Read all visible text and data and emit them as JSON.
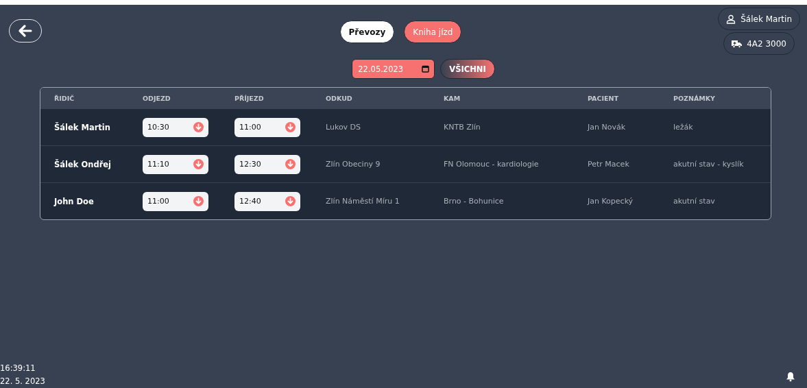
{
  "tabs": [
    {
      "label": "Převozy",
      "selected": true
    },
    {
      "label": "Kniha jízd",
      "selected": false
    }
  ],
  "user": {
    "name": "Šálek Martin"
  },
  "vehicle": {
    "plate": "4A2 3000"
  },
  "filter": {
    "date": "22.05.2023",
    "button": "VŠICHNI"
  },
  "table": {
    "columns": [
      "ŘIDIČ",
      "ODJEZD",
      "PŘÍJEZD",
      "ODKUD",
      "KAM",
      "PACIENT",
      "POZNÁMKY"
    ],
    "rows": [
      {
        "driver": "Šálek Martin",
        "departure": "10:30",
        "arrival": "11:00",
        "from": "Lukov DS",
        "to": "KNTB Zlín",
        "patient": "Jan Novák",
        "notes": "ležák"
      },
      {
        "driver": "Šálek Ondřej",
        "departure": "11:10",
        "arrival": "12:30",
        "from": "Zlín Obeciny 9",
        "to": "FN Olomouc - kardiologie",
        "patient": "Petr Macek",
        "notes": "akutní stav - kyslík"
      },
      {
        "driver": "John Doe",
        "departure": "11:00",
        "arrival": "12:40",
        "from": "Zlín Náměstí Míru 1",
        "to": "Brno - Bohunice",
        "patient": "Jan Kopecký",
        "notes": "akutní stav"
      }
    ]
  },
  "status": {
    "time": "16:39:11",
    "date": "22. 5. 2023"
  }
}
